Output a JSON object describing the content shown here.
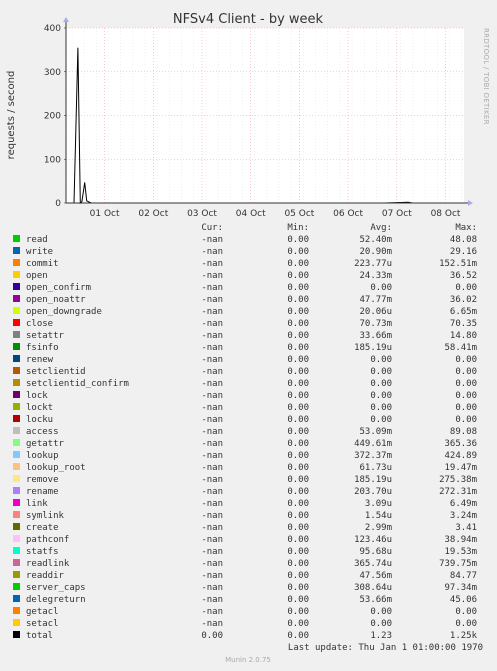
{
  "chart_data": {
    "type": "line",
    "title": "NFSv4 Client - by week",
    "ylabel": "requests / second",
    "ylim": [
      0,
      400
    ],
    "yticks": [
      0,
      100,
      200,
      300,
      400
    ],
    "xticks": [
      "01 Oct",
      "02 Oct",
      "03 Oct",
      "04 Oct",
      "05 Oct",
      "06 Oct",
      "07 Oct",
      "08 Oct"
    ],
    "grid": true,
    "series": [
      {
        "name": "total",
        "x": [
          0.0,
          0.02,
          0.03,
          0.036,
          0.04,
          0.047,
          0.052,
          0.058,
          0.064,
          0.08,
          0.2,
          0.5,
          0.8,
          0.86,
          0.87,
          0.88,
          0.94
        ],
        "values": [
          0,
          0,
          355,
          0,
          3,
          47,
          5,
          2,
          0,
          0,
          0,
          0,
          0,
          1.5,
          0,
          0,
          0
        ]
      }
    ],
    "legend_headers": [
      "Cur:",
      "Min:",
      "Avg:",
      "Max:"
    ],
    "legend": [
      {
        "name": "read",
        "color": "#00cc00",
        "cur": "-nan",
        "min": "0.00",
        "avg": "52.40m",
        "max": "48.08"
      },
      {
        "name": "write",
        "color": "#0066b3",
        "cur": "-nan",
        "min": "0.00",
        "avg": "20.90m",
        "max": "29.16"
      },
      {
        "name": "commit",
        "color": "#ff8000",
        "cur": "-nan",
        "min": "0.00",
        "avg": "223.77u",
        "max": "152.51m"
      },
      {
        "name": "open",
        "color": "#ffcc00",
        "cur": "-nan",
        "min": "0.00",
        "avg": "24.33m",
        "max": "36.52"
      },
      {
        "name": "open_confirm",
        "color": "#330099",
        "cur": "-nan",
        "min": "0.00",
        "avg": "0.00",
        "max": "0.00"
      },
      {
        "name": "open_noattr",
        "color": "#990099",
        "cur": "-nan",
        "min": "0.00",
        "avg": "47.77m",
        "max": "36.02"
      },
      {
        "name": "open_downgrade",
        "color": "#ccff00",
        "cur": "-nan",
        "min": "0.00",
        "avg": "20.06u",
        "max": "6.65m"
      },
      {
        "name": "close",
        "color": "#ff0000",
        "cur": "-nan",
        "min": "0.00",
        "avg": "70.73m",
        "max": "70.35"
      },
      {
        "name": "setattr",
        "color": "#808080",
        "cur": "-nan",
        "min": "0.00",
        "avg": "33.66m",
        "max": "14.80"
      },
      {
        "name": "fsinfo",
        "color": "#008f00",
        "cur": "-nan",
        "min": "0.00",
        "avg": "185.19u",
        "max": "58.41m"
      },
      {
        "name": "renew",
        "color": "#00487d",
        "cur": "-nan",
        "min": "0.00",
        "avg": "0.00",
        "max": "0.00"
      },
      {
        "name": "setclientid",
        "color": "#b35a00",
        "cur": "-nan",
        "min": "0.00",
        "avg": "0.00",
        "max": "0.00"
      },
      {
        "name": "setclientid_confirm",
        "color": "#b38f00",
        "cur": "-nan",
        "min": "0.00",
        "avg": "0.00",
        "max": "0.00"
      },
      {
        "name": "lock",
        "color": "#6b006b",
        "cur": "-nan",
        "min": "0.00",
        "avg": "0.00",
        "max": "0.00"
      },
      {
        "name": "lockt",
        "color": "#8fb300",
        "cur": "-nan",
        "min": "0.00",
        "avg": "0.00",
        "max": "0.00"
      },
      {
        "name": "locku",
        "color": "#b30000",
        "cur": "-nan",
        "min": "0.00",
        "avg": "0.00",
        "max": "0.00"
      },
      {
        "name": "access",
        "color": "#bebebe",
        "cur": "-nan",
        "min": "0.00",
        "avg": "53.09m",
        "max": "89.08"
      },
      {
        "name": "getattr",
        "color": "#80ff80",
        "cur": "-nan",
        "min": "0.00",
        "avg": "449.61m",
        "max": "365.36"
      },
      {
        "name": "lookup",
        "color": "#80c9ff",
        "cur": "-nan",
        "min": "0.00",
        "avg": "372.37m",
        "max": "424.89"
      },
      {
        "name": "lookup_root",
        "color": "#ffc080",
        "cur": "-nan",
        "min": "0.00",
        "avg": "61.73u",
        "max": "19.47m"
      },
      {
        "name": "remove",
        "color": "#ffe680",
        "cur": "-nan",
        "min": "0.00",
        "avg": "185.19u",
        "max": "275.38m"
      },
      {
        "name": "rename",
        "color": "#aa80ff",
        "cur": "-nan",
        "min": "0.00",
        "avg": "203.70u",
        "max": "272.31m"
      },
      {
        "name": "link",
        "color": "#ee00cc",
        "cur": "-nan",
        "min": "0.00",
        "avg": "3.09u",
        "max": "6.49m"
      },
      {
        "name": "symlink",
        "color": "#ff8080",
        "cur": "-nan",
        "min": "0.00",
        "avg": "1.54u",
        "max": "3.24m"
      },
      {
        "name": "create",
        "color": "#666600",
        "cur": "-nan",
        "min": "0.00",
        "avg": "2.99m",
        "max": "3.41"
      },
      {
        "name": "pathconf",
        "color": "#ffbfff",
        "cur": "-nan",
        "min": "0.00",
        "avg": "123.46u",
        "max": "38.94m"
      },
      {
        "name": "statfs",
        "color": "#00ffcc",
        "cur": "-nan",
        "min": "0.00",
        "avg": "95.68u",
        "max": "19.53m"
      },
      {
        "name": "readlink",
        "color": "#cc6699",
        "cur": "-nan",
        "min": "0.00",
        "avg": "365.74u",
        "max": "739.75m"
      },
      {
        "name": "readdir",
        "color": "#999900",
        "cur": "-nan",
        "min": "0.00",
        "avg": "47.56m",
        "max": "84.77"
      },
      {
        "name": "server_caps",
        "color": "#00cc00",
        "cur": "-nan",
        "min": "0.00",
        "avg": "308.64u",
        "max": "97.34m"
      },
      {
        "name": "delegreturn",
        "color": "#0066b3",
        "cur": "-nan",
        "min": "0.00",
        "avg": "53.66m",
        "max": "45.06"
      },
      {
        "name": "getacl",
        "color": "#ff8000",
        "cur": "-nan",
        "min": "0.00",
        "avg": "0.00",
        "max": "0.00"
      },
      {
        "name": "setacl",
        "color": "#ffcc00",
        "cur": "-nan",
        "min": "0.00",
        "avg": "0.00",
        "max": "0.00"
      },
      {
        "name": "total",
        "color": "#000000",
        "cur": "0.00",
        "min": "0.00",
        "avg": "1.23",
        "max": "1.25k"
      }
    ],
    "last_update": "Last update: Thu Jan  1 01:00:00 1970",
    "side_label": "RRDTOOL / TOBI OETIKER",
    "footer": "Munin 2.0.75"
  }
}
